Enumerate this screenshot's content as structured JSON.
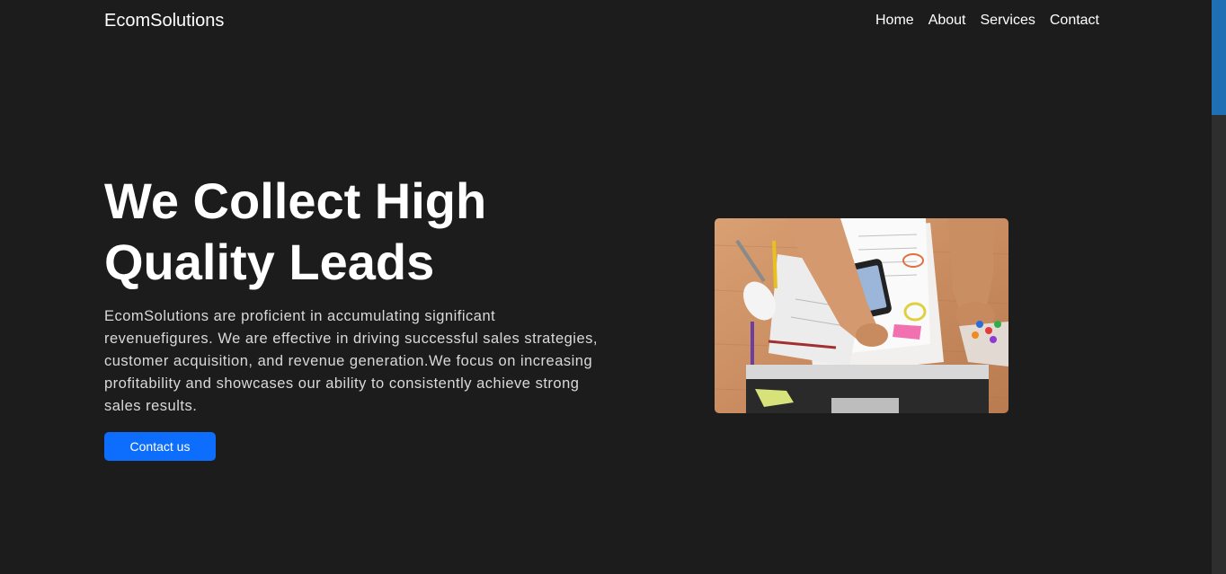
{
  "nav": {
    "brand": "EcomSolutions",
    "links": [
      "Home",
      "About",
      "Services",
      "Contact"
    ]
  },
  "hero": {
    "title_line1": "We Collect High",
    "title_line2": "Quality Leads",
    "description": "EcomSolutions are proficient in accumulating significant revenuefigures. We are effective in driving successful sales strategies, customer acquisition, and revenue generation.We focus on increasing profitability and showcases our ability to consistently achieve strong sales results.",
    "cta_label": "Contact us"
  },
  "colors": {
    "background": "#1c1c1c",
    "accent": "#0d6efd",
    "scroll_thumb": "#1f6fb5"
  },
  "icons": {
    "hero_image": "desk-workspace-photo"
  }
}
